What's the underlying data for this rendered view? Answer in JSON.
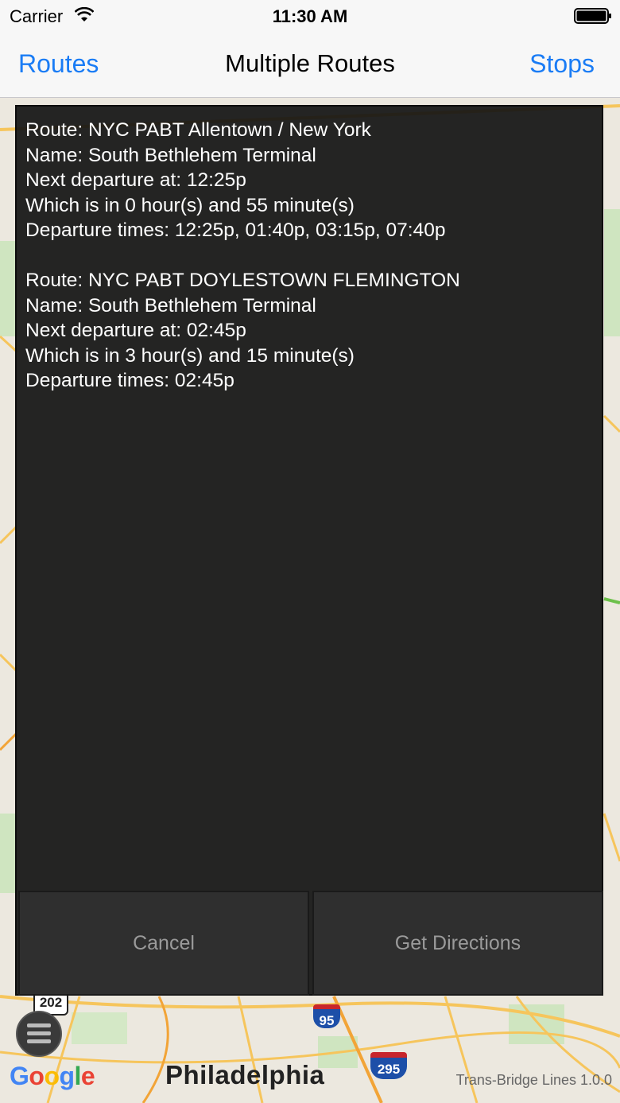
{
  "status_bar": {
    "carrier": "Carrier",
    "time": "11:30 AM"
  },
  "nav": {
    "left_label": "Routes",
    "title": "Multiple Routes",
    "right_label": "Stops"
  },
  "routes": [
    {
      "route": "Route: NYC PABT Allentown / New York",
      "name": "Name: South Bethlehem Terminal",
      "next": "Next departure at: 12:25p",
      "which": "Which is in 0 hour(s) and 55 minute(s)",
      "times": "Departure times: 12:25p, 01:40p, 03:15p, 07:40p"
    },
    {
      "route": "Route: NYC PABT DOYLESTOWN FLEMINGTON",
      "name": "Name: South Bethlehem Terminal",
      "next": "Next departure at: 02:45p",
      "which": "Which is in 3 hour(s) and 15 minute(s)",
      "times": "Departure times: 02:45p"
    }
  ],
  "buttons": {
    "cancel": "Cancel",
    "directions": "Get Directions"
  },
  "map": {
    "city": "Philadelphia",
    "google_logo": [
      "G",
      "o",
      "o",
      "g",
      "l",
      "e"
    ],
    "version": "Trans-Bridge Lines 1.0.0",
    "shields": {
      "us202": "202",
      "i95": "95",
      "i295": "295"
    }
  },
  "colors": {
    "ios_blue": "#1a7cf5",
    "dialog_bg": "#141414",
    "button_bg": "#2f2f2f"
  },
  "icons": {
    "wifi": "wifi-icon",
    "battery": "battery-icon",
    "menu": "hamburger-menu-icon"
  }
}
